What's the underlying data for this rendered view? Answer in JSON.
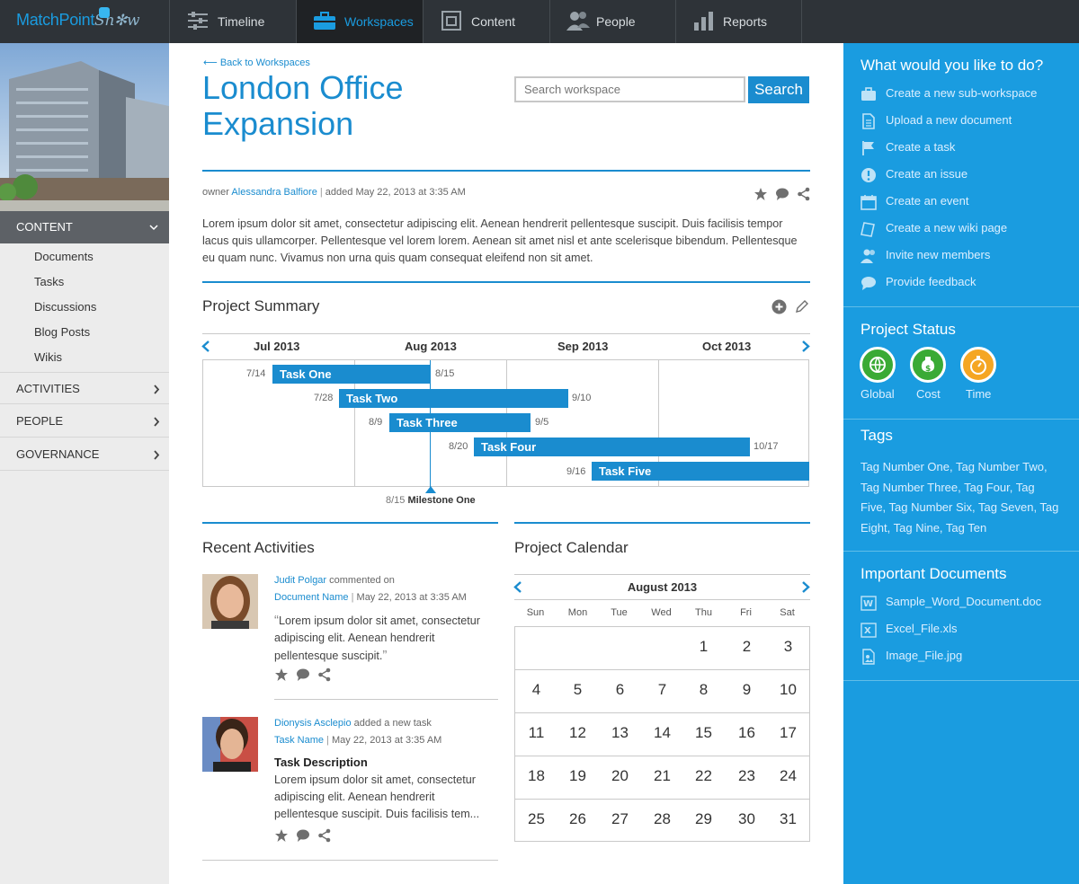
{
  "app": {
    "brand_main": "MatchPoint",
    "brand_snow": "Sn✻w"
  },
  "nav": [
    {
      "label": "Timeline",
      "icon": "timeline-icon"
    },
    {
      "label": "Workspaces",
      "icon": "briefcase-icon",
      "active": true
    },
    {
      "label": "Content",
      "icon": "document-icon"
    },
    {
      "label": "People",
      "icon": "people-icon"
    },
    {
      "label": "Reports",
      "icon": "bar-chart-icon"
    }
  ],
  "sidebar": {
    "content_header": "CONTENT",
    "content_items": [
      "Documents",
      "Tasks",
      "Discussions",
      "Blog Posts",
      "Wikis"
    ],
    "sections": [
      "ACTIVITIES",
      "PEOPLE",
      "GOVERNANCE"
    ]
  },
  "workspace": {
    "back_link": "Back to Workspaces",
    "title_line1": "London Office",
    "title_line2": "Expansion",
    "owner_prefix": "owner",
    "owner": "Alessandra Balfiore",
    "added": "added May 22, 2013 at 3:35 AM",
    "description": "Lorem ipsum dolor sit amet, consectetur adipiscing elit. Aenean hendrerit pellentesque suscipit. Duis facilisis tempor lacus quis ullamcorper. Pellentesque vel lorem lorem. Aenean sit amet nisl et ante scelerisque bibendum. Pellentesque eu quam nunc. Vivamus non urna quis quam consequat eleifend non sit amet."
  },
  "search": {
    "placeholder": "Search workspace",
    "button": "Search"
  },
  "project_summary": {
    "title": "Project Summary",
    "months": [
      "Jul 2013",
      "Aug 2013",
      "Sep 2013",
      "Oct 2013"
    ],
    "tasks": [
      {
        "name": "Task One",
        "start": "7/14",
        "end": "8/15"
      },
      {
        "name": "Task Two",
        "start": "7/28",
        "end": "9/10"
      },
      {
        "name": "Task Three",
        "start": "8/9",
        "end": "9/5"
      },
      {
        "name": "Task Four",
        "start": "8/20",
        "end": "10/17"
      },
      {
        "name": "Task Five",
        "start": "9/16",
        "end": ""
      }
    ],
    "milestone_date": "8/15",
    "milestone_name": "Milestone One"
  },
  "recent": {
    "title": "Recent Activities",
    "items": [
      {
        "user": "Judit Polgar",
        "action": "commented on",
        "target": "Document Name",
        "time": "May 22, 2013 at 3:35 AM",
        "quote": "Lorem ipsum dolor sit amet, consectetur adipiscing elit. Aenean hendrerit pellentesque suscipit."
      },
      {
        "user": "Dionysis Asclepio",
        "action": "added a new task",
        "target": "Task Name",
        "time": "May 22, 2013 at 3:35 AM",
        "heading": "Task Description",
        "body": "Lorem ipsum dolor sit amet, consectetur adipiscing elit. Aenean hendrerit pellentesque suscipit. Duis facilisis tem..."
      }
    ]
  },
  "calendar": {
    "title": "Project Calendar",
    "month": "August 2013",
    "weekdays": [
      "Sun",
      "Mon",
      "Tue",
      "Wed",
      "Thu",
      "Fri",
      "Sat"
    ],
    "days": [
      "1",
      "2",
      "3",
      "4",
      "5",
      "6",
      "7",
      "8",
      "9",
      "10",
      "11",
      "12",
      "13",
      "14",
      "15",
      "16",
      "17",
      "18",
      "19",
      "20",
      "21",
      "22",
      "23",
      "24",
      "25",
      "26",
      "27",
      "28",
      "29",
      "30",
      "31"
    ]
  },
  "right": {
    "todo_title": "What would you like to do?",
    "actions": [
      "Create a new sub-workspace",
      "Upload a new document",
      "Create a task",
      "Create an issue",
      "Create an event",
      "Create a new wiki page",
      "Invite new members",
      "Provide feedback"
    ],
    "status_title": "Project Status",
    "status": [
      {
        "label": "Global",
        "color": "#3aaa35"
      },
      {
        "label": "Cost",
        "color": "#3aaa35"
      },
      {
        "label": "Time",
        "color": "#f5a623"
      }
    ],
    "tags_title": "Tags",
    "tags": "Tag Number One, Tag Number Two, Tag Number Three, Tag Four, Tag Five, Tag Number Six, Tag Seven, Tag Eight, Tag Nine, Tag Ten",
    "docs_title": "Important Documents",
    "docs": [
      "Sample_Word_Document.doc",
      "Excel_File.xls",
      "Image_File.jpg"
    ]
  },
  "colors": {
    "accent": "#1a8ccf",
    "panel": "#1a9ce0",
    "topbar": "#2e3338"
  }
}
